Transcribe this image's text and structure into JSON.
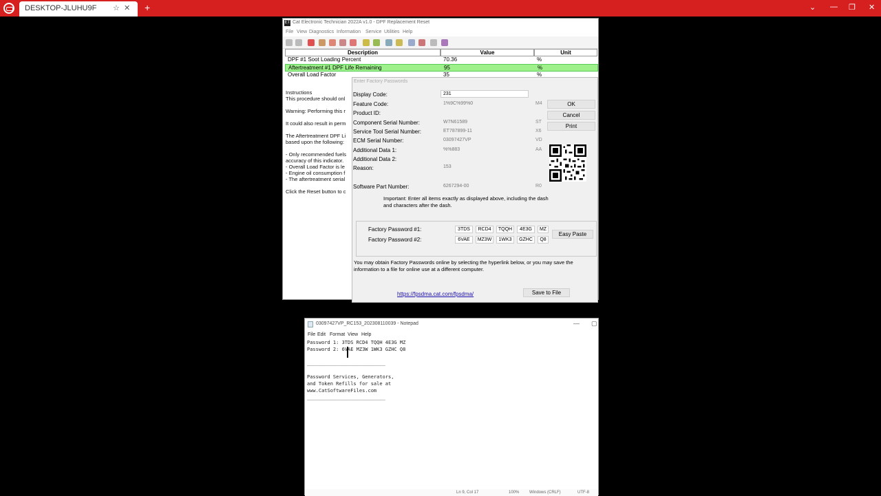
{
  "viewer": {
    "tab_title": "DESKTOP-JLUHU9F",
    "star": "☆",
    "close": "✕",
    "new_tab": "+",
    "controls": [
      "⌄",
      "—",
      "❐",
      "✕"
    ]
  },
  "et": {
    "title": "Cat Electronic Technician 2022A v1.0 - DPF Replacement Reset",
    "menu": [
      "File",
      "View",
      "Diagnostics",
      "Information",
      "Service",
      "Utilities",
      "Help"
    ],
    "table": {
      "headers": [
        "Description",
        "Value",
        "Unit"
      ],
      "rows": [
        {
          "desc": "DPF #1 Soot Loading Percent",
          "value": "70.36",
          "unit": "%"
        },
        {
          "desc": "Aftertreatment #1 DPF Life Remaining",
          "value": "95",
          "unit": "%"
        },
        {
          "desc": "Overall Load Factor",
          "value": "35",
          "unit": "%"
        }
      ]
    },
    "instructions": [
      "Instructions",
      "This procedure should onl",
      "",
      "Warning: Performing this r",
      "",
      "It could also result in perm",
      "",
      "The Aftertreatment DPF Li",
      "based upon the following:",
      "",
      "- Only recommended fuels",
      "accuracy of this indicator.",
      "- Overall Load Factor is le",
      "- Engine oil consumption f",
      "- The aftertreatment serial",
      "",
      "Click the Reset button to c"
    ]
  },
  "dialog": {
    "title": "Enter Factory Passwords",
    "fields": [
      {
        "label": "Display Code:",
        "value": "231",
        "code": ""
      },
      {
        "label": "Feature Code:",
        "value": "1%9C%99%0",
        "code": "M4"
      },
      {
        "label": "Product ID:",
        "value": "",
        "code": ""
      },
      {
        "label": "Component Serial Number:",
        "value": "W7N61589",
        "code": "ST"
      },
      {
        "label": "Service Tool Serial Number:",
        "value": "ET787899-11",
        "code": "X6"
      },
      {
        "label": "ECM Serial Number:",
        "value": "03097427VP",
        "code": "VD"
      },
      {
        "label": "Additional Data 1:",
        "value": "%%883",
        "code": "AA"
      },
      {
        "label": "Additional Data 2:",
        "value": "",
        "code": ""
      },
      {
        "label": "Reason:",
        "value": "153",
        "code": ""
      },
      {
        "label": "Software Part Number:",
        "value": "6267294-00",
        "code": "R0"
      }
    ],
    "buttons": {
      "ok": "OK",
      "cancel": "Cancel",
      "print": "Print",
      "easy_paste": "Easy Paste",
      "save": "Save to File"
    },
    "important": "Important: Enter all items exactly as displayed above, including the dash and characters after the dash.",
    "pw1_label": "Factory Password #1:",
    "pw2_label": "Factory Password #2:",
    "pw1": [
      "3TDS",
      "RCD4",
      "TQQH",
      "4E3G",
      "MZ"
    ],
    "pw2": [
      "6VAE",
      "MZ3W",
      "1WK3",
      "GZHC",
      "Q8"
    ],
    "obtain": "You may obtain Factory Passwords online by selecting the hyperlink below, or you may save the information to a file for online use at a different computer.",
    "link": "https://fpsdma.cat.com/fpsdma/"
  },
  "notepad": {
    "title": "03097427VP_RC153_20230811003​9 - Notepad",
    "menu": [
      "File",
      "Edit",
      "Format",
      "View",
      "Help"
    ],
    "text": "Password 1: 3TDS RCD4 TQQH 4E3G MZ\nPassword 2: 6VAE MZ3W 1WK3 GZHC Q8\n\n___________________________\n\nPassword Services, Generators,\nand Token Refills for sale at\nwww.CatSoftwareFiles.com\n___________________________",
    "status": {
      "pos": "Ln 9, Col 17",
      "zoom": "100%",
      "eol": "Windows (CRLF)",
      "enc": "UTF-8"
    }
  },
  "colors": {
    "viewer_bar": "#d61f1f",
    "highlight_row": "#9ef08a"
  }
}
